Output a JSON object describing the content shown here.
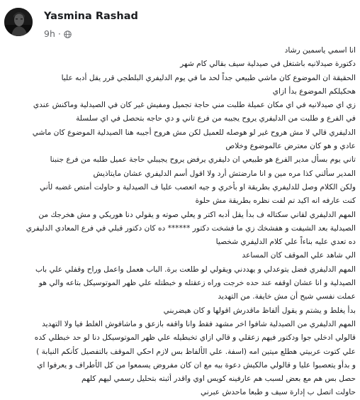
{
  "author": {
    "name": "Yasmina Rashad"
  },
  "post_meta": {
    "time": "9h",
    "separator": "·",
    "audience_icon": "globe-icon"
  },
  "post": {
    "lines": [
      "انا اسمي ياسمين رشاد",
      "دكتورة صيدلانيه باشتغل في صيدلية سيف بقالي كام شهر",
      "الحقيقة ان الموضوع كان ماشي طبيعي جداً لحد ما في يوم الدليفري البلطجي قرر يقل أدبه عليا",
      "هحكيلكم الموضوع بدأ ازاي",
      "زي اي صيدلانيه في اي مكان عميلة طلبت مني حاجة تجميل ومفيش غير كان في الصيدلية وماكنش عندي",
      "في الفرع و طلبت من الدليفري يروح يجيبه من فرع تاني و دي حاجه بتحصل في اي سلسلة",
      "الدليفري قالي لا مش هروح غير لو هوصله للعميل لكن مش هروح أجيبه هنا الصيدلية الموضوع كان ماشي",
      "عادي و هو كان معترض عالموضوع وخلاص",
      "تاني يوم بسأل مدير الفرع هو طبيعي ان دليفري يرفض يروح يجيبلي حاجة عميل طلبه من فرع جنبنا",
      "المدير سألني كذا مره مين و انا مارضتش أرد ولا اقول أسم الدليفري عشان مايتاذيش",
      "ولكن الكلام وصل للدليفري بطريقة او بأخري و جيه اتعصب عليا ف الصيدلية و حاولت أمتص غضبه لأني",
      "كنت عارفه انه اكيد تم لفت نظره بطريقة مش حلوة",
      "المهم الدليفري لقاني سكتاله ف بدأ يقل أدبه اكتر و يعلي صوته و يقولي دنا هوريكي و مش هخرجك من",
      "الصيدلية بعد الشيفت و هفشخك زي ما فشخت دكتور ****** ده كان دكتور قبلي في فرع المعادي الدليفري",
      "ده تعدي عليه بناءاً علي كلام الدليفري شخصيا",
      "الي شاهد علي الموقف كان المساعد",
      "المهم الدليفري فضل يتوعدلي و يهددني ويقولي لو طلعت برة. الباب هعمل واعمل وراح وقفلي علي باب",
      "الصيدلية و انا عشان اوقفه عند حده خرجت وراه زعقتله و خبطتله علي ظهر الموتوسيكل بتاعه والي هو",
      "عملت نفسي شيح أن مش خايفة. من التهديد",
      "بدأ يغلط و يشتم و يقول ألفاظ ماقدرش اقولها و كان هيضربني",
      "المهم الدليفري من الصيدلية شافوا اخر مشهد فقط وانا واقفه بازعق و ماشافوش الغلط فيا ولا التهديد",
      "قالولي ادخلي جوا ودكتور فيهم زعقلي و قالي ازاي تخبطيله علي ظهر الموتوسيكل دنا لو حد خبطلي كده",
      "علي كتوت عربيتي هطلع ميتين امه (اسفة. علي الألفاظ بس لازم احكي الموقف بالتفصيل كأنكم النيابة )",
      "و بدأو يتعصبوا عليا و قالولي مالكيش دعوة بيه مع ان كان مفروض يسمعوا من كل الأطراف و يعرفوا اي",
      "حصل بس هم مع بعض لسبب هم عارفينه كويس اوي واقدر أثبته بتحليل رسمي ليهم كلهم",
      "حاولت اتصل ب إدارة سيف و طبعا ماحدش عبرني"
    ]
  }
}
